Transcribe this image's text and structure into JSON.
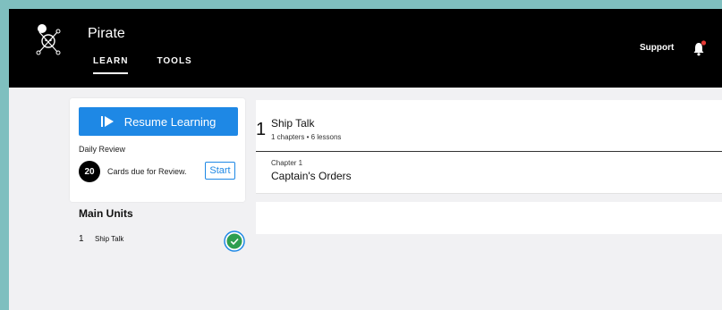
{
  "header": {
    "app_name": "Pirate",
    "nav": [
      {
        "label": "LEARN",
        "active": true
      },
      {
        "label": "TOOLS",
        "active": false
      }
    ],
    "support_label": "Support",
    "notification_icon": "bell-icon",
    "notification_dot_color": "#e53935",
    "logo_icon": "skull-crossbones-icon"
  },
  "sidebar": {
    "resume_label": "Resume Learning",
    "resume_icon": "play-skip-icon",
    "daily_review_label": "Daily Review",
    "cards_due_count": "20",
    "cards_due_text": "Cards due for Review.",
    "start_label": "Start",
    "main_units_heading": "Main Units",
    "units": [
      {
        "number": "1",
        "name": "Ship Talk",
        "status_icon": "check-circle-icon",
        "complete": true
      }
    ]
  },
  "unit_panel": {
    "number": "1",
    "title": "Ship Talk",
    "meta": "1 chapters • 6 lessons",
    "chapters": [
      {
        "label": "Chapter 1",
        "title": "Captain's Orders"
      }
    ]
  },
  "colors": {
    "accent": "#1e88e5",
    "complete": "#2e9e4f",
    "header_bg": "#000000",
    "page_bg": "#f1f1f3"
  }
}
